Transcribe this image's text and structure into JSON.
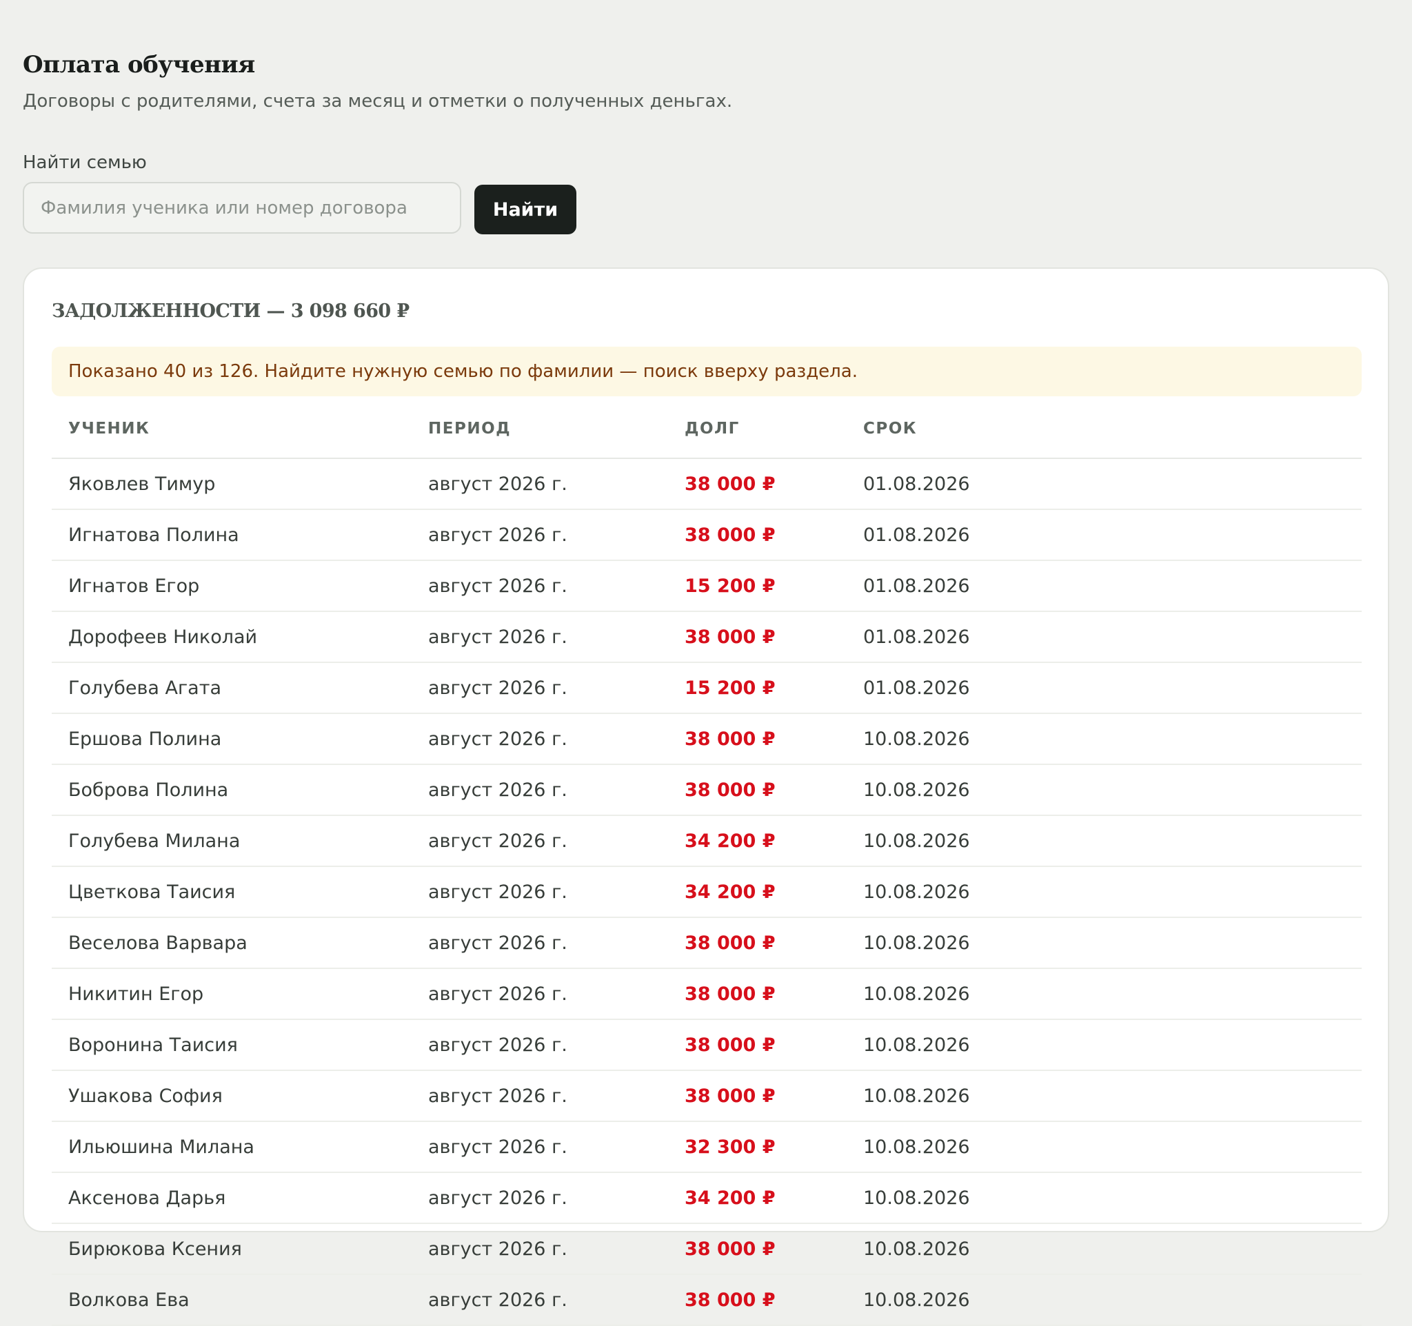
{
  "header": {
    "title": "Оплата обучения",
    "subtitle": "Договоры с родителями, счета за месяц и отметки о полученных деньгах."
  },
  "search": {
    "label": "Найти семью",
    "placeholder": "Фамилия ученика или номер договора",
    "value": "",
    "button_label": "Найти"
  },
  "debts": {
    "heading": "ЗАДОЛЖЕННОСТИ — 3 098 660 ₽",
    "notice": "Показано 40 из 126. Найдите нужную семью по фамилии — поиск вверху раздела.",
    "columns": [
      "УЧЕНИК",
      "ПЕРИОД",
      "ДОЛГ",
      "СРОК"
    ],
    "rows": [
      {
        "student": "Яковлев Тимур",
        "period": "август 2026 г.",
        "amount": "38 000 ₽",
        "due": "01.08.2026"
      },
      {
        "student": "Игнатова Полина",
        "period": "август 2026 г.",
        "amount": "38 000 ₽",
        "due": "01.08.2026"
      },
      {
        "student": "Игнатов Егор",
        "period": "август 2026 г.",
        "amount": "15 200 ₽",
        "due": "01.08.2026"
      },
      {
        "student": "Дорофеев Николай",
        "period": "август 2026 г.",
        "amount": "38 000 ₽",
        "due": "01.08.2026"
      },
      {
        "student": "Голубева Агата",
        "period": "август 2026 г.",
        "amount": "15 200 ₽",
        "due": "01.08.2026"
      },
      {
        "student": "Ершова Полина",
        "period": "август 2026 г.",
        "amount": "38 000 ₽",
        "due": "10.08.2026"
      },
      {
        "student": "Боброва Полина",
        "period": "август 2026 г.",
        "amount": "38 000 ₽",
        "due": "10.08.2026"
      },
      {
        "student": "Голубева Милана",
        "period": "август 2026 г.",
        "amount": "34 200 ₽",
        "due": "10.08.2026"
      },
      {
        "student": "Цветкова Таисия",
        "period": "август 2026 г.",
        "amount": "34 200 ₽",
        "due": "10.08.2026"
      },
      {
        "student": "Веселова Варвара",
        "period": "август 2026 г.",
        "amount": "38 000 ₽",
        "due": "10.08.2026"
      },
      {
        "student": "Никитин Егор",
        "period": "август 2026 г.",
        "amount": "38 000 ₽",
        "due": "10.08.2026"
      },
      {
        "student": "Воронина Таисия",
        "period": "август 2026 г.",
        "amount": "38 000 ₽",
        "due": "10.08.2026"
      },
      {
        "student": "Ушакова София",
        "period": "август 2026 г.",
        "amount": "38 000 ₽",
        "due": "10.08.2026"
      },
      {
        "student": "Ильюшина Милана",
        "period": "август 2026 г.",
        "amount": "32 300 ₽",
        "due": "10.08.2026"
      },
      {
        "student": "Аксенова Дарья",
        "period": "август 2026 г.",
        "amount": "34 200 ₽",
        "due": "10.08.2026"
      },
      {
        "student": "Бирюкова Ксения",
        "period": "август 2026 г.",
        "amount": "38 000 ₽",
        "due": "10.08.2026"
      },
      {
        "student": "Волкова Ева",
        "period": "август 2026 г.",
        "amount": "38 000 ₽",
        "due": "10.08.2026"
      }
    ]
  },
  "colors": {
    "background": "#eff0ed",
    "card": "#ffffff",
    "button": "#1b201d",
    "debt_amount": "#d70f1b",
    "notice_bg": "#fdf8e4",
    "notice_text": "#7b3a0c"
  }
}
